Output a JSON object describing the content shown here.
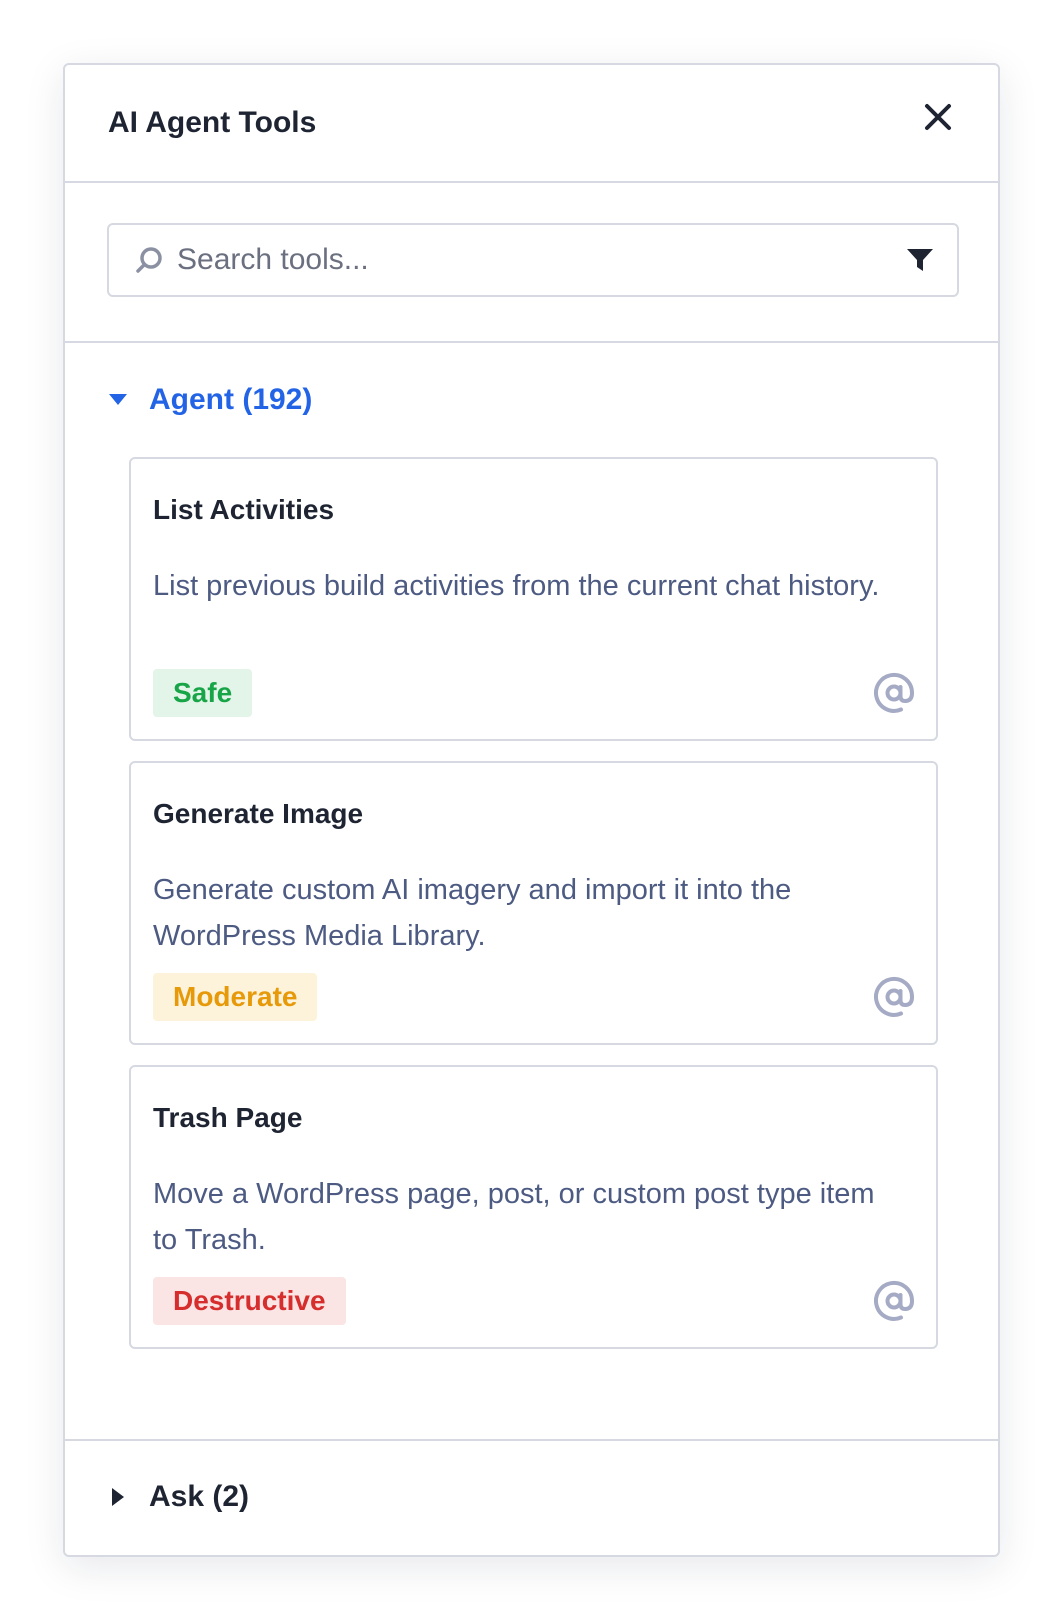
{
  "panel": {
    "title": "AI Agent Tools",
    "close_icon": "close-icon"
  },
  "search": {
    "placeholder": "Search tools...",
    "value": "",
    "search_icon": "search-icon",
    "filter_icon": "filter-icon"
  },
  "groups": {
    "agent": {
      "label": "Agent (192)",
      "expanded": true,
      "caret_icon": "caret-down-icon",
      "tools": [
        {
          "name": "List Activities",
          "description": "List previous build activities from the current chat history.",
          "risk": "Safe",
          "risk_level": "safe",
          "action_icon": "at-sign-icon"
        },
        {
          "name": "Generate Image",
          "description": "Generate custom AI imagery and import it into the WordPress Media Library.",
          "risk": "Moderate",
          "risk_level": "moderate",
          "action_icon": "at-sign-icon"
        },
        {
          "name": "Trash Page",
          "description": "Move a WordPress page, post, or custom post type item to Trash.",
          "risk": "Destructive",
          "risk_level": "destructive",
          "action_icon": "at-sign-icon"
        }
      ]
    },
    "ask": {
      "label": "Ask (2)",
      "expanded": false,
      "caret_icon": "caret-right-icon"
    }
  },
  "colors": {
    "accent": "#2364e6",
    "text": "#1e2432",
    "description": "#4d5b83",
    "border": "#d6d9e1",
    "safe": "#18a547",
    "moderate": "#e69a0a",
    "destructive": "#d62d2d",
    "icon_muted": "#a5abc4"
  }
}
